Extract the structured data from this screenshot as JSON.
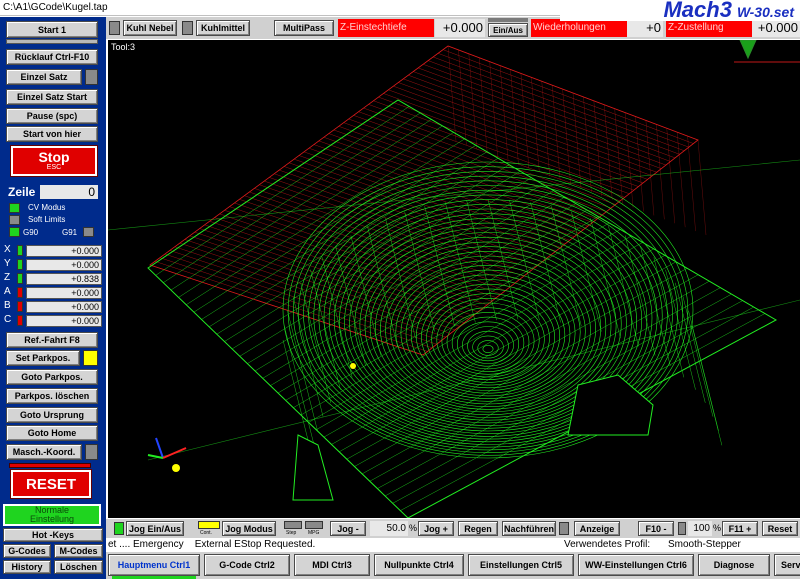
{
  "window": {
    "file_path": "C:\\A1\\GCode\\Kugel.tap"
  },
  "branding": {
    "logo": "Mach3",
    "profile_name": "W-30.set"
  },
  "left_panel": {
    "start_label": "Start 1",
    "ruecklauf_label": "Rücklauf Ctrl-F10",
    "einzel_satz_label": "Einzel Satz",
    "einzel_satz_start_label": "Einzel Satz Start",
    "pause_label": "Pause (spc)",
    "start_von_hier_label": "Start von hier",
    "stop_label": "Stop",
    "stop_sub": "ESC",
    "zeile_label": "Zeile",
    "zeile_value": "0",
    "cv_modus_label": "CV Modus",
    "soft_limits_label": "Soft Limits",
    "g90_label": "G90",
    "g91_label": "G91",
    "axes": [
      {
        "name": "X",
        "value": "+0.000",
        "color": "#1fd41f"
      },
      {
        "name": "Y",
        "value": "+0.000",
        "color": "#1fd41f"
      },
      {
        "name": "Z",
        "value": "+0.838",
        "color": "#1fd41f"
      },
      {
        "name": "A",
        "value": "+0.000",
        "color": "#e00000"
      },
      {
        "name": "B",
        "value": "+0.000",
        "color": "#e00000"
      },
      {
        "name": "C",
        "value": "+0.000",
        "color": "#e00000"
      }
    ],
    "ref_fahrt_label": "Ref.-Fahrt F8",
    "set_parkpos_label": "Set Parkpos.",
    "goto_parkpos_label": "Goto Parkpos.",
    "parkpos_loeschen_label": "Parkpos. löschen",
    "goto_ursprung_label": "Goto Ursprung",
    "goto_home_label": "Goto Home",
    "masch_koord_label": "Masch.-Koord.",
    "reset_label": "RESET",
    "normale_label_1": "Normale",
    "normale_label_2": "Einstellung",
    "hot_keys_label": "Hot -Keys",
    "g_codes_label": "G-Codes",
    "m_codes_label": "M-Codes",
    "history_label": "History",
    "loeschen_label": "Löschen"
  },
  "top_toolbar": {
    "kuhl_nebel_label": "Kuhl Nebel",
    "kuhlmittel_label": "Kuhlmittel",
    "multipass_label": "MultiPass",
    "z_einstechtiefe_label": "Z-Einstechtiefe",
    "z_einstechtiefe_value": "+0.000",
    "ein_aus_label": "Ein/Aus",
    "wiederholungen_label": "Wiederholungen",
    "wiederholungen_value": "+0",
    "z_zustellung_label": "Z-Zustellung",
    "z_zustellung_value": "+0.000"
  },
  "viewport": {
    "tool_label": "Tool:3"
  },
  "jog_bar": {
    "jog_ein_aus_label": "Jog Ein/Aus",
    "cont_label": "Cont.",
    "jog_modus_label": "Jog Modus",
    "step_label": "Step",
    "mpg_label": "MPG",
    "jog_minus_label": "Jog -",
    "jog_percent": "50.0",
    "percent_sign": "%",
    "jog_plus_label": "Jog +",
    "regen_label": "Regen",
    "nachfuehren_label": "Nachführen",
    "anzeige_label": "Anzeige",
    "f10_label": "F10 -",
    "feed_percent": "100",
    "f11_label": "F11 +",
    "reset_label": "Reset"
  },
  "status_bar": {
    "message": "et .... Emergency    External EStop Requested.",
    "profile_label": "Verwendetes Profil:",
    "profile_value": "Smooth-Stepper"
  },
  "tabs": [
    {
      "label": "Hauptmenu Ctrl1",
      "active": true
    },
    {
      "label": "G-Code Ctrl2",
      "active": false
    },
    {
      "label": "MDI Ctrl3",
      "active": false
    },
    {
      "label": "Nullpunkte Ctrl4",
      "active": false
    },
    {
      "label": "Einstellungen Ctrl5",
      "active": false
    },
    {
      "label": "WW-Einstellungen Ctrl6",
      "active": false
    },
    {
      "label": "Diagnose",
      "active": false
    },
    {
      "label": "Service",
      "active": false
    }
  ],
  "colors": {
    "panel_blue": "#002b8c",
    "toolpath_green": "#22ee22",
    "boundary_red": "#dd1a1a",
    "led_green": "#1fd41f"
  }
}
